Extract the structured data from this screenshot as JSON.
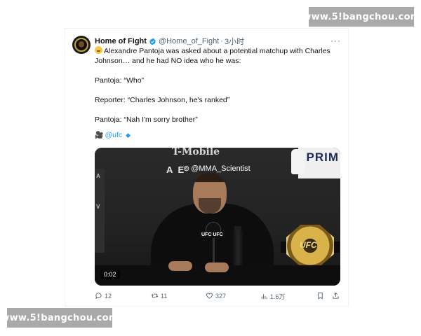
{
  "watermarks": {
    "top": "www.5!bangchou.com",
    "bottom": "www.5!bangchou.com"
  },
  "tweet": {
    "display_name": "Home of Fight",
    "handle": "@Home_of_Fight",
    "separator": "·",
    "time": "3小时",
    "more_label": "···",
    "text": {
      "line1": "Alexandre Pantoja was asked about a potential matchup with Charles Johnson… and he had NO idea who he was:",
      "line2": "Pantoja: “Who”",
      "line3": "Reporter: “Charles Johnson, he's ranked”",
      "line4": "Pantoja: “Nah I'm sorry brother”",
      "mention": "@ufc"
    },
    "video": {
      "overlay_watermark": "@MMA_Scientist",
      "sponsor_top": "T-Mobile",
      "arena_text": "A  E",
      "prime_text": "PRIM",
      "mic_label": "UFC UFC",
      "belt_text": "UFC",
      "duration": "0:02",
      "left_banner_1": "A",
      "left_banner_2": "V"
    },
    "actions": {
      "replies": "12",
      "retweets": "11",
      "likes": "327",
      "views": "1.6万"
    },
    "colors": {
      "accent": "#1d9bf0",
      "muted": "#536471",
      "text": "#0f1419"
    }
  }
}
